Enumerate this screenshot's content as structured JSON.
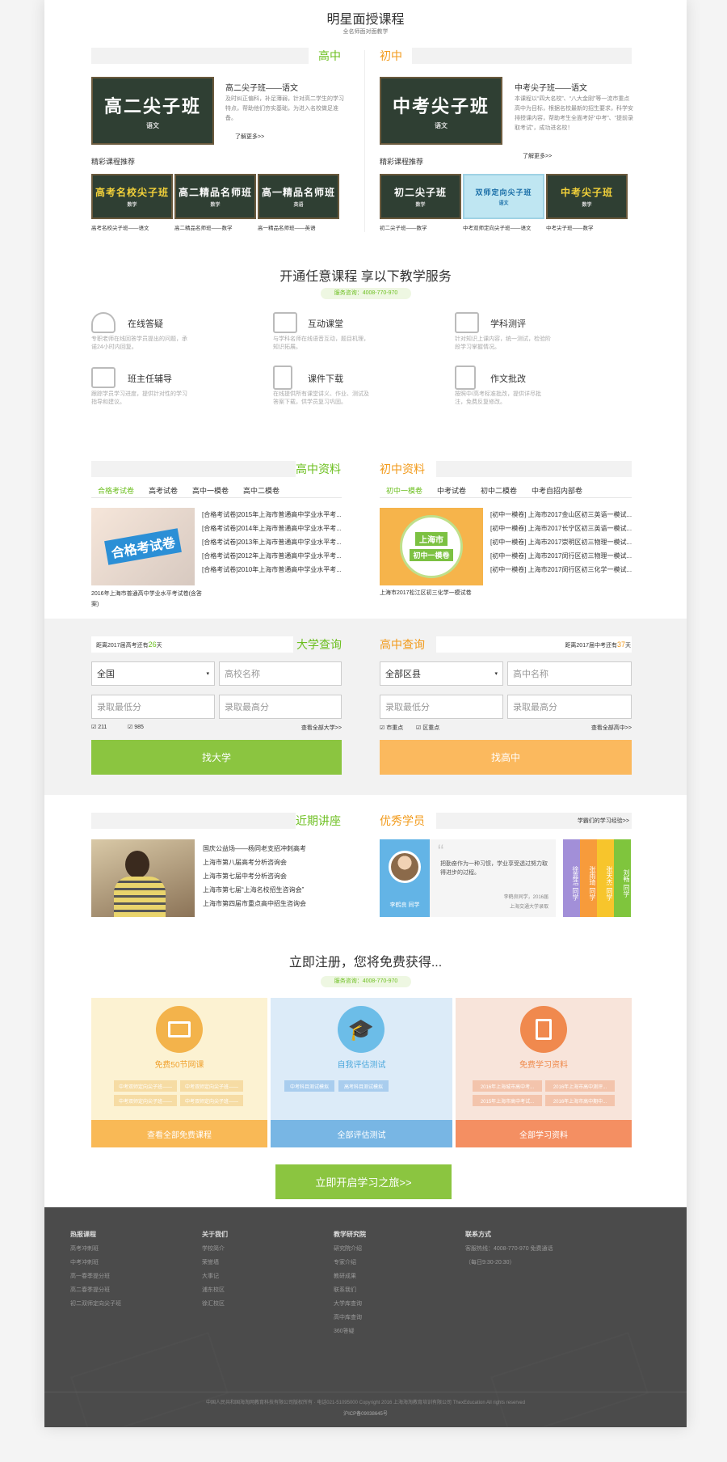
{
  "courses": {
    "title": "明星面授课程",
    "subtitle": "全名师面对面教学",
    "senior": {
      "heading": "高中",
      "board_main": "高二尖子班",
      "board_sub": "语文",
      "course_title": "高二尖子班——语文",
      "desc": "及时纠正偏科，补足薄弱，针对高二学生的学习特点，帮助他们夯实基础，为进入名校做足准备。",
      "more": "了解更多>>",
      "recommend": "精彩课程推荐",
      "thumbs": [
        {
          "board": "高考名校尖子班",
          "sub": "数学",
          "label": "高考名校尖子班——语文"
        },
        {
          "board": "高二精品名师班",
          "sub": "数学",
          "label": "高二精品名师班——数学"
        },
        {
          "board": "高一精品名师班",
          "sub": "英语",
          "label": "高一精品名师班——英语"
        }
      ]
    },
    "junior": {
      "heading": "初中",
      "board_main": "中考尖子班",
      "board_sub": "语文",
      "course_title": "中考尖子班——语文",
      "desc": "本课程以“四大名校”、“八大金刚”等一流市重点高中为目标，根据名校最新的招生要求，科学安排授课内容，帮助考生全面考好“中考”、“提前录取考试”，成功进名校！",
      "more": "了解更多>>",
      "recommend": "精彩课程推荐",
      "thumbs": [
        {
          "board": "初二尖子班",
          "sub": "数学",
          "label": "初二尖子班——数学"
        },
        {
          "board": "双师定向尖子班",
          "sub": "语文",
          "label": "中考双师定向尖子班——语文"
        },
        {
          "board": "中考尖子班",
          "sub": "数学",
          "label": "中考尖子班——数学"
        }
      ]
    }
  },
  "services": {
    "title": "开通任意课程 享以下教学服务",
    "hotline": "服务咨询：4008-770-970",
    "items": [
      {
        "icon": "headset-icon",
        "title": "在线答疑",
        "desc": "专职老师在线回答学员提出的问题，承诺24小时内回复。"
      },
      {
        "icon": "video-play-icon",
        "title": "互动课堂",
        "desc": "与学科名师在线语音互动，题目机理，知识拓展。"
      },
      {
        "icon": "chart-board-icon",
        "title": "学科测评",
        "desc": "针对知识上课内容，统一测试，检验阶段学习掌握情况。"
      },
      {
        "icon": "books-icon",
        "title": "班主任辅导",
        "desc": "跟踪学员学习进度，提供针对性的学习指导和建议。"
      },
      {
        "icon": "download-doc-icon",
        "title": "课件下载",
        "desc": "在线提供所有课堂讲义、作业、测试及答案下载，供学员复习巩固。"
      },
      {
        "icon": "pen-edit-icon",
        "title": "作文批改",
        "desc": "按照中/高考标准批改，提供详尽批注，免费反复修改。"
      }
    ]
  },
  "materials": {
    "senior": {
      "heading": "高中资料",
      "tabs": [
        "合格考试卷",
        "高考试卷",
        "高中一模卷",
        "高中二模卷"
      ],
      "image_text": "合格考试卷",
      "caption": "2016年上海市普通高中学业水平考试卷(含答案)",
      "list": [
        "[合格考试卷]2015年上海市普通高中学业水平考...",
        "[合格考试卷]2014年上海市普通高中学业水平考...",
        "[合格考试卷]2013年上海市普通高中学业水平考...",
        "[合格考试卷]2012年上海市普通高中学业水平考...",
        "[合格考试卷]2010年上海市普通高中学业水平考..."
      ]
    },
    "junior": {
      "heading": "初中资料",
      "tabs": [
        "初中一模卷",
        "中考试卷",
        "初中二模卷",
        "中考自招内部卷"
      ],
      "image_text_1": "上海市",
      "image_text_2": "初中一模卷",
      "caption": "上海市2017松江区初三化学一模试卷",
      "list": [
        "[初中一模卷] 上海市2017金山区初三英语一模试...",
        "[初中一模卷] 上海市2017长宁区初三英语一模试...",
        "[初中一模卷] 上海市2017崇明区初三物理一模试...",
        "[初中一模卷] 上海市2017闵行区初三物理一模试...",
        "[初中一模卷] 上海市2017闵行区初三化学一模试..."
      ]
    }
  },
  "query": {
    "university": {
      "countdown_prefix": "距离2017届高考还有",
      "countdown_days": "26",
      "countdown_suffix": "天",
      "heading": "大学查询",
      "region": "全国",
      "school_placeholder": "高校名称",
      "min_placeholder": "录取最低分",
      "max_placeholder": "录取最高分",
      "check1": "211",
      "check2": "985",
      "view_all": "查看全部大学>>",
      "button": "找大学"
    },
    "highschool": {
      "heading": "高中查询",
      "countdown_prefix": "距离2017届中考还有",
      "countdown_days": "37",
      "countdown_suffix": "天",
      "region": "全部区县",
      "school_placeholder": "高中名称",
      "min_placeholder": "录取最低分",
      "max_placeholder": "录取最高分",
      "check1": "市重点",
      "check2": "区重点",
      "view_all": "查看全部高中>>",
      "button": "找高中"
    }
  },
  "lectures": {
    "heading": "近期讲座",
    "list": [
      "国庆公益场——杨同老支招冲刺高考",
      "上海市第八届高考分析咨询会",
      "上海市第七届中考分析咨询会",
      "上海市第七届“上海名校招生咨询会”",
      "上海市第四届市重点高中招生咨询会"
    ]
  },
  "students": {
    "heading": "优秀学员",
    "link": "学霸们的学习经验>>",
    "name": "李鹤良 同学",
    "quote": "把勤奋作为一种习惯，学业享受透过努力取得进步的过程。",
    "sign": "李鹤良同学，2016届",
    "school": "上海交通大学录取",
    "others": [
      "徐嘉浩 同学",
      "张雨琦 同学",
      "张天杰 同学",
      "刘畅 同学"
    ],
    "other_colors": [
      "#a28fd8",
      "#f79b3b",
      "#f7c52c",
      "#7fc53d"
    ]
  },
  "register": {
    "title": "立即注册，您将免费获得...",
    "hotline": "服务咨询：4008-770-970",
    "cards": [
      {
        "icon": "monitor-icon",
        "title": "免费50节网课",
        "items": [
          "中考双师定向尖子班——",
          "中考双师定向尖子班——",
          "中考双师定向尖子班——",
          "中考双师定向尖子班——"
        ],
        "button": "查看全部免费课程",
        "bg": "#fcf2d2",
        "accent": "#f3b34b",
        "btn": "#f9b956",
        "pill": "#f6dca4"
      },
      {
        "icon": "graduation-cap-icon",
        "title": "自我评估测试",
        "items": [
          "中考科目测试模拟",
          "高考科目测试模拟"
        ],
        "button": "全部评估测试",
        "bg": "#dcebf8",
        "accent": "#6cbde8",
        "btn": "#78b6e4",
        "pill": "#a9cdee"
      },
      {
        "icon": "document-icon",
        "title": "免费学习资料",
        "items": [
          "2016年上海城市高中考...",
          "2016年上海市高中测评...",
          "2015年上海市高中考试...",
          "2016年上海市高中期中..."
        ],
        "button": "全部学习资料",
        "bg": "#f8e4da",
        "accent": "#f0894e",
        "btn": "#f48f62",
        "pill": "#f3c4ac"
      }
    ],
    "cta": "立即开启学习之旅>>"
  },
  "footer": {
    "cols": [
      {
        "title": "热报课程",
        "items": [
          "高考冲刺班",
          "中考冲刺班",
          "高一春季提分班",
          "高二春季提分班",
          "初二双师定向尖子班"
        ]
      },
      {
        "title": "关于我们",
        "items": [
          "学校简介",
          "荣誉墙",
          "大事记",
          "浦东校区",
          "徐汇校区"
        ]
      },
      {
        "title": "教学研究院",
        "items": [
          "研究院介绍",
          "专家介绍",
          "教研成果",
          "联系我们",
          "大学库查询",
          "高中库查询",
          "360答疑"
        ]
      },
      {
        "title": "联系方式",
        "items": [
          "客服热线：4008-770-970 免费通话",
          "（每日9:30-20:30）"
        ]
      }
    ],
    "copyright": "中国人民共和国海淘网教育科技有限公司版权所有 · 电话021-51095000 Copyright 2016 上海海淘教育培训有限公司 ThexEducation All rights reserved",
    "icp": "沪ICP备09038645号"
  }
}
